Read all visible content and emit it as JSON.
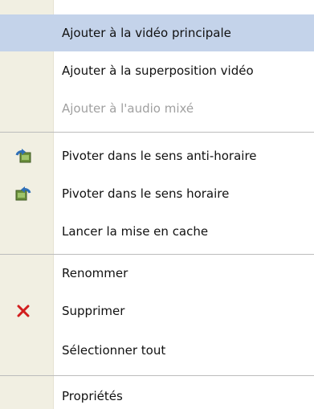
{
  "menu": {
    "items": [
      {
        "label": "Ajouter à la vidéo principale",
        "state": "highlighted"
      },
      {
        "label": "Ajouter à la superposition vidéo"
      },
      {
        "label": "Ajouter à l'audio mixé",
        "state": "disabled"
      },
      {
        "label": "Pivoter dans le sens anti-horaire",
        "icon": "rotate-counterclockwise-icon"
      },
      {
        "label": "Pivoter dans le sens horaire",
        "icon": "rotate-clockwise-icon"
      },
      {
        "label": "Lancer la mise en cache"
      },
      {
        "label": "Renommer"
      },
      {
        "label": "Supprimer",
        "icon": "delete-x-icon"
      },
      {
        "label": "Sélectionner tout"
      },
      {
        "label": "Propriétés"
      }
    ]
  },
  "colors": {
    "gutter": "#f1efe2",
    "highlight": "#c4d3ea",
    "disabled_text": "#a0a0a0",
    "delete_icon": "#d21e1e",
    "rotate_icon_green": "#3b9a3b",
    "rotate_icon_blue": "#2f6fb7"
  }
}
